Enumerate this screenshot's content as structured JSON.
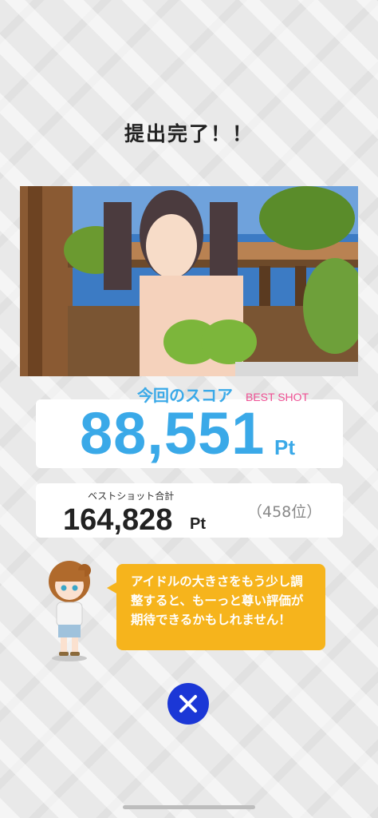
{
  "header": {
    "title": "提出完了！！"
  },
  "score": {
    "label": "今回のスコア",
    "badge": "BEST SHOT",
    "value": "88,551",
    "unit": "Pt",
    "accent_color": "#3aa9e8",
    "badge_color": "#ef4f93"
  },
  "total": {
    "label": "ベストショット合計",
    "value": "164,828",
    "unit": "Pt",
    "rank": "（458位）"
  },
  "advice": {
    "message": "アイドルの大きさをもう少し調整すると、もーっと尊い評価が期待できるかもしれません！",
    "bubble_color": "#f6b41c"
  },
  "actions": {
    "close_icon": "close-icon",
    "close_color": "#1b37d6"
  }
}
